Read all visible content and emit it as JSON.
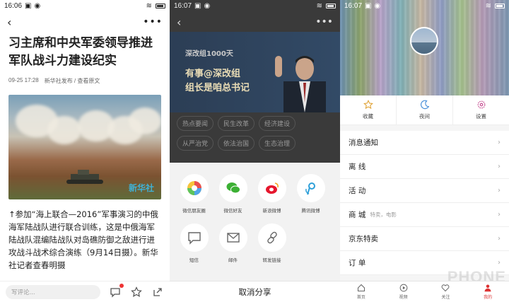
{
  "panel_article": {
    "status": {
      "time": "16:06"
    },
    "title": "习主席和中央军委领导推进军队战斗力建设纪实",
    "meta": {
      "date": "09-25 17:28",
      "source": "新华社发布 / 查看原文"
    },
    "image_watermark": "新华社",
    "body": "↑参加“海上联合—2016”军事演习的中俄海军陆战队进行联合训练，这是中俄海军陆战队混编陆战队对岛礁防御之敌进行进攻战斗战术综合演练（9月14日摄）。新华社记者查春明摄",
    "comment_placeholder": "写评论..."
  },
  "panel_share": {
    "status": {
      "time": "16:07"
    },
    "banner": {
      "small": "深改组1000天",
      "line1": "有事@深改组",
      "line2": "组长是咱总书记"
    },
    "tags": [
      "热点要闻",
      "民生改革",
      "经济建设",
      "从严治党",
      "依法治国",
      "生态治理"
    ],
    "share_row1": [
      {
        "label": "微信朋友圈",
        "icon": "moments-icon"
      },
      {
        "label": "微信好友",
        "icon": "wechat-icon"
      },
      {
        "label": "新浪微博",
        "icon": "weibo-icon"
      },
      {
        "label": "腾讯微博",
        "icon": "tencent-weibo-icon"
      }
    ],
    "share_row2": [
      {
        "label": "短信",
        "icon": "sms-icon"
      },
      {
        "label": "邮件",
        "icon": "mail-icon"
      },
      {
        "label": "转发链接",
        "icon": "link-icon"
      }
    ],
    "cancel": "取消分享"
  },
  "panel_profile": {
    "status": {
      "time": "16:07"
    },
    "quick": [
      {
        "label": "收藏",
        "icon": "star-icon"
      },
      {
        "label": "夜间",
        "icon": "moon-icon"
      },
      {
        "label": "设置",
        "icon": "gear-icon"
      }
    ],
    "menu": [
      {
        "label": "消息通知",
        "sub": ""
      },
      {
        "label": "离 线",
        "sub": ""
      },
      {
        "label": "活 动",
        "sub": ""
      },
      {
        "label": "商 城",
        "sub": "特卖，电影"
      },
      {
        "label": "京东特卖",
        "sub": ""
      },
      {
        "label": "订 单",
        "sub": ""
      }
    ],
    "tabs": [
      {
        "label": "首页"
      },
      {
        "label": "视频"
      },
      {
        "label": "关注"
      },
      {
        "label": "我的"
      }
    ],
    "watermark": "PHONE"
  },
  "colors": {
    "accent_red": "#d33333",
    "share_bg": "#f2f2f2",
    "dim_overlay": "#3a3a3a"
  }
}
